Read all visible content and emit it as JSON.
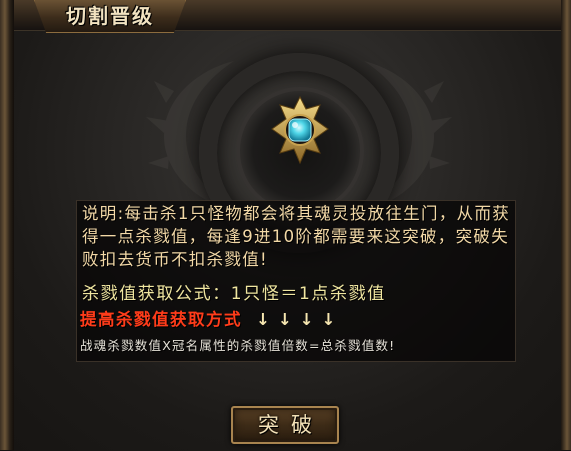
{
  "window": {
    "title": "切割晋级"
  },
  "description": "说明:每击杀1只怪物都会将其魂灵投放往生门，从而获得一点杀戮值，每逢9进10阶都需要来这突破，突破失败扣去货币不扣杀戮值!",
  "formula": "杀戮值获取公式：1只怪＝1点杀戮值",
  "method": {
    "label": "提高杀戮值获取方式",
    "arrows": "↓↓↓↓"
  },
  "note": "战魂杀戮数值X冠名属性的杀戮值倍数=总杀戮值数!",
  "actions": {
    "breakthrough_label": "突破"
  },
  "icons": {
    "emblem": "gem-emblem-icon"
  },
  "colors": {
    "description_text": "#f3d9a7",
    "formula_text": "#f0e6a0",
    "method_text": "#ff3c1a",
    "note_text": "#e6e2d8",
    "gem": "#4fd6e8",
    "gold": "#c9a24f"
  }
}
